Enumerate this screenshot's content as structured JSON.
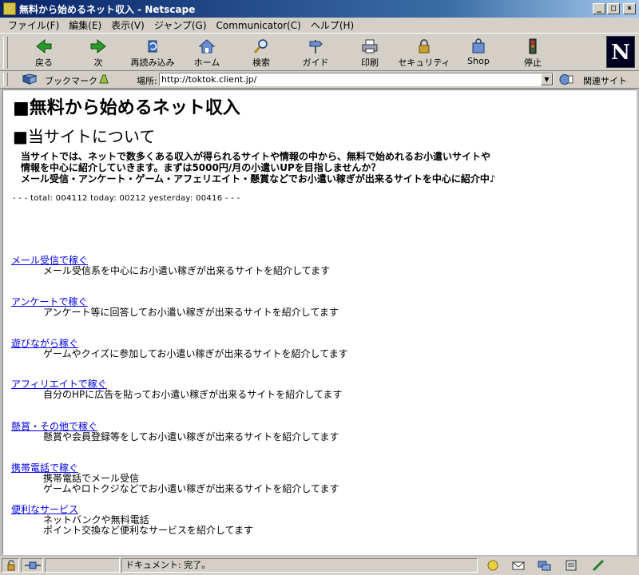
{
  "window": {
    "title": "無料から始めるネット収入 - Netscape",
    "minimize": "_",
    "maximize": "□",
    "close": "×"
  },
  "menu": [
    "ファイル(F)",
    "編集(E)",
    "表示(V)",
    "ジャンプ(G)",
    "Communicator(C)",
    "ヘルプ(H)"
  ],
  "toolbar": {
    "back": "戻る",
    "forward": "次",
    "reload": "再読み込み",
    "home": "ホーム",
    "search": "検索",
    "guide": "ガイド",
    "print": "印刷",
    "security": "セキュリティ",
    "shop": "Shop",
    "stop": "停止",
    "logo": "N"
  },
  "location": {
    "bookmarks_label": "ブックマーク",
    "label": "場所:",
    "url": "http://toktok.client.jp/",
    "dropdown": "▼",
    "related_label": "関連サイト"
  },
  "page": {
    "heading": "■無料から始めるネット収入",
    "section_heading": "■当サイトについて",
    "intro": [
      "当サイトでは、ネットで数多くある収入が得られるサイトや情報の中から、無料で始めれるお小遣いサイトや",
      "情報を中心に紹介していきます。まずは5000円/月の小遣いUPを目指しませんか？",
      "メール受信・アンケート・ゲーム・アフェリエイト・懸賞などでお小遣い稼ぎが出来るサイトを中心に紹介中♪"
    ],
    "counter": "- - -  total: 004112  today: 00212  yesterday: 00416  - - -",
    "links": [
      {
        "title": "メール受信で稼ぐ",
        "desc": [
          "メール受信系を中心にお小遣い稼ぎが出来るサイトを紹介してます"
        ]
      },
      {
        "title": "アンケートで稼ぐ",
        "desc": [
          "アンケート等に回答してお小遣い稼ぎが出来るサイトを紹介してます"
        ]
      },
      {
        "title": "遊びながら稼ぐ",
        "desc": [
          "ゲームやクイズに参加してお小遣い稼ぎが出来るサイトを紹介してます"
        ]
      },
      {
        "title": "アフィリエイトで稼ぐ",
        "desc": [
          "自分のHPに広告を貼ってお小遣い稼ぎが出来るサイトを紹介してます"
        ]
      },
      {
        "title": "懸賞・その他で稼ぐ",
        "desc": [
          "懸賞や会員登録等をしてお小遣い稼ぎが出来るサイトを紹介してます"
        ]
      },
      {
        "title": "携帯電話で稼ぐ",
        "desc": [
          "携帯電話でメール受信",
          "ゲームやロトクジなどでお小遣い稼ぎが出来るサイトを紹介してます"
        ]
      },
      {
        "title": "便利なサービス",
        "desc": [
          "ネットバンクや無料電話",
          "ポイント交換など便利なサービスを紹介してます"
        ]
      }
    ]
  },
  "status": {
    "text": "ドキュメント: 完了。"
  }
}
